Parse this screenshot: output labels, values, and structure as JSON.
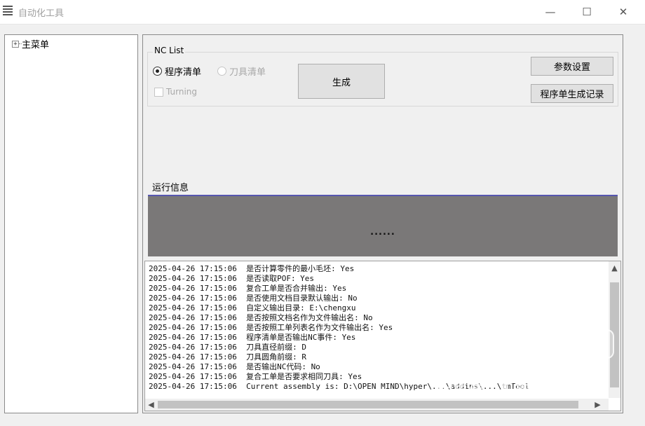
{
  "window": {
    "title": "自动化工具",
    "minimize_glyph": "—",
    "maximize_glyph": "☐",
    "close_glyph": "✕"
  },
  "tree": {
    "root_expander": "+",
    "root_label": "主菜单"
  },
  "nc_list": {
    "group_title": "NC List",
    "radio_program": "程序清单",
    "radio_program_checked": true,
    "radio_tool": "刀具清单",
    "radio_tool_enabled": false,
    "checkbox_turning": "Turning",
    "checkbox_turning_enabled": false,
    "generate_button": "生成",
    "params_button": "参数设置",
    "history_button": "程序单生成记录"
  },
  "run_info": {
    "label": "运行信息",
    "progress_text": "......"
  },
  "log": {
    "lines": [
      "2025-04-26 17:15:06  是否计算零件的最小毛坯: Yes",
      "2025-04-26 17:15:06  是否读取POF: Yes",
      "2025-04-26 17:15:06  复合工单是否合并输出: Yes",
      "2025-04-26 17:15:06  是否使用文档目录默认输出: No",
      "2025-04-26 17:15:06  自定义输出目录: E:\\chengxu",
      "2025-04-26 17:15:06  是否按照文档名作为文件输出名: No",
      "2025-04-26 17:15:06  是否按照工单列表名作为文件输出名: Yes",
      "2025-04-26 17:15:06  程序清单是否输出NC事件: Yes",
      "2025-04-26 17:15:06  刀具直径前缀: D",
      "2025-04-26 17:15:06  刀具圆角前缀: R",
      "2025-04-26 17:15:06  是否输出NC代码: No",
      "2025-04-26 17:15:06  复合工单是否要求相同刀具: Yes",
      "2025-04-26 17:15:06  Current assembly is: D:\\OPEN MIND\\hyper\\...\\addins\\...\\tmTool"
    ],
    "scroll_up": "▲",
    "scroll_left": "◀",
    "scroll_right": "▶"
  },
  "watermark": {
    "badge": "闲鱼",
    "text": "闲鱼号：机械WAS"
  }
}
